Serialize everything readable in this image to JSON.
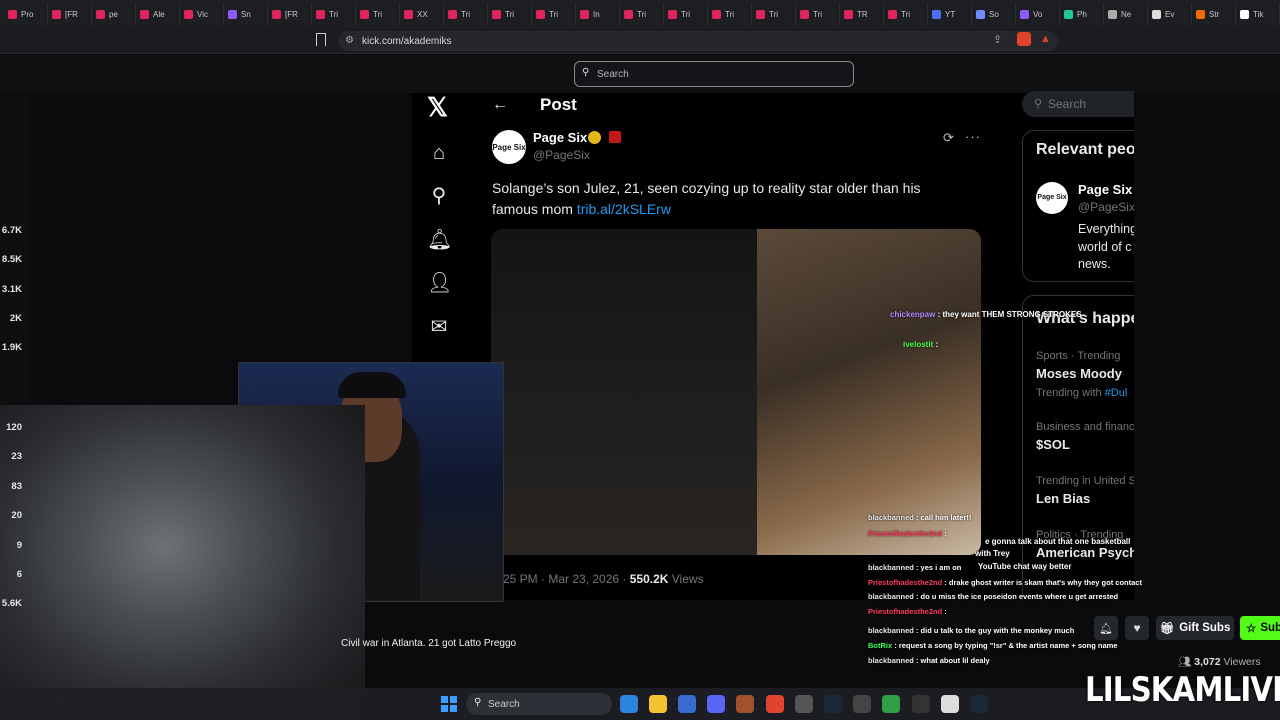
{
  "browser": {
    "tabs": [
      {
        "label": "Pro",
        "color": "#e0245e"
      },
      {
        "label": "[FR",
        "color": "#e0245e"
      },
      {
        "label": "pe",
        "color": "#e0245e"
      },
      {
        "label": "Ale",
        "color": "#e0245e"
      },
      {
        "label": "Vic",
        "color": "#e0245e"
      },
      {
        "label": "Sn",
        "color": "#8b5cf6"
      },
      {
        "label": "[FR",
        "color": "#e0245e"
      },
      {
        "label": "Tri",
        "color": "#e0245e"
      },
      {
        "label": "Tri",
        "color": "#e0245e"
      },
      {
        "label": "XX",
        "color": "#e0245e"
      },
      {
        "label": "Tri",
        "color": "#e0245e"
      },
      {
        "label": "Tri",
        "color": "#e0245e"
      },
      {
        "label": "Tri",
        "color": "#e0245e"
      },
      {
        "label": "In",
        "color": "#e0245e"
      },
      {
        "label": "Tri",
        "color": "#e0245e"
      },
      {
        "label": "Tri",
        "color": "#e0245e"
      },
      {
        "label": "Tri",
        "color": "#e0245e"
      },
      {
        "label": "Tri",
        "color": "#e0245e"
      },
      {
        "label": "Tri",
        "color": "#e0245e"
      },
      {
        "label": "TR",
        "color": "#e0245e"
      },
      {
        "label": "Tri",
        "color": "#e0245e"
      },
      {
        "label": "YT",
        "color": "#4c6ef5"
      },
      {
        "label": "So",
        "color": "#6c8cff"
      },
      {
        "label": "Vo",
        "color": "#8b5cf6"
      },
      {
        "label": "Ph",
        "color": "#20c997"
      },
      {
        "label": "Ne",
        "color": "#aaaaaa"
      },
      {
        "label": "Ev",
        "color": "#dddddd"
      },
      {
        "label": "Str",
        "color": "#f76707"
      },
      {
        "label": "Tik",
        "color": "#ffffff"
      }
    ],
    "url": "kick.com/akademiks"
  },
  "kick": {
    "search_placeholder": "Search",
    "sidebar_counts": [
      "6.7K",
      "8.5K",
      "3.1K",
      "2K",
      "1.9K",
      "120",
      "23",
      "83",
      "20",
      "9",
      "6",
      "5.6K"
    ],
    "caption": "Civil war in Atlanta. 21 got Latto Preggo",
    "buttons": {
      "gift": "Gift Subs",
      "sub": "Sub"
    },
    "viewers_count": "3,072",
    "viewers_label": "Viewers",
    "watermark": "LILSKAMLIVE",
    "chat": [
      {
        "user": "blackbanned",
        "msg": "call him later!!",
        "user_class": ""
      },
      {
        "user": "Priestofhadesthe2nd",
        "msg": "",
        "user_class": "red"
      },
      {
        "user": "blackbanned",
        "msg": "yes i am on",
        "user_class": ""
      },
      {
        "user": "Priestofhadesthe2nd",
        "msg": "drake ghost writer is skam that's why they got contact",
        "user_class": "red"
      },
      {
        "user": "blackbanned",
        "msg": "do u miss the ice poseidon events where u get arrested",
        "user_class": ""
      },
      {
        "user": "Priestofhadesthe2nd",
        "msg": "",
        "user_class": "red"
      },
      {
        "user": "blackbanned",
        "msg": "did u talk to the guy with the monkey much",
        "user_class": ""
      },
      {
        "user": "BotRix",
        "msg": "request a song by typing \"!sr\" & the artist name + song name",
        "user_class": "green"
      },
      {
        "user": "blackbanned",
        "msg": "what about lil dealy",
        "user_class": ""
      }
    ],
    "chat_floats": [
      {
        "user": "chickenpaw",
        "msg": "they want THEM STRONG STROKES"
      },
      {
        "user": "ivelostit",
        "msg": ""
      },
      {
        "user": "",
        "msg": "e gonna talk about that one basketball"
      },
      {
        "user": "",
        "msg": "with Trey"
      },
      {
        "user": "",
        "msg": "YouTube chat way better"
      }
    ]
  },
  "x": {
    "page_title": "Post",
    "author_name": "Page Six",
    "author_handle": "@PageSix",
    "avatar_text": "Page Six",
    "post_text": "Solange’s son Julez, 21, seen cozying up to reality star older than his famous mom ",
    "post_link": "trib.al/2kSLErw",
    "post_time": "25 PM · Mar 23, 2026 · ",
    "post_views": "550.2K",
    "post_views_label": " Views",
    "search_placeholder": "Search",
    "relevant_title": "Relevant people",
    "relevant_name": "Page Six",
    "relevant_handle": "@PageSix",
    "relevant_bio": "Everything world of c news.",
    "happening_title": "What's happening",
    "trends": [
      {
        "category": "Sports · Trending",
        "name": "Moses Moody",
        "sub": "Trending with ",
        "sub_link": "#Dul"
      },
      {
        "category": "Business and finance",
        "name": "$SOL",
        "sub": "",
        "sub_link": ""
      },
      {
        "category": "Trending in United States",
        "name": "Len Bias",
        "sub": "",
        "sub_link": ""
      },
      {
        "category": "Politics · Trending",
        "name": "American Psych",
        "sub": "",
        "sub_link": ""
      }
    ]
  },
  "taskbar": {
    "search_placeholder": "Search"
  }
}
